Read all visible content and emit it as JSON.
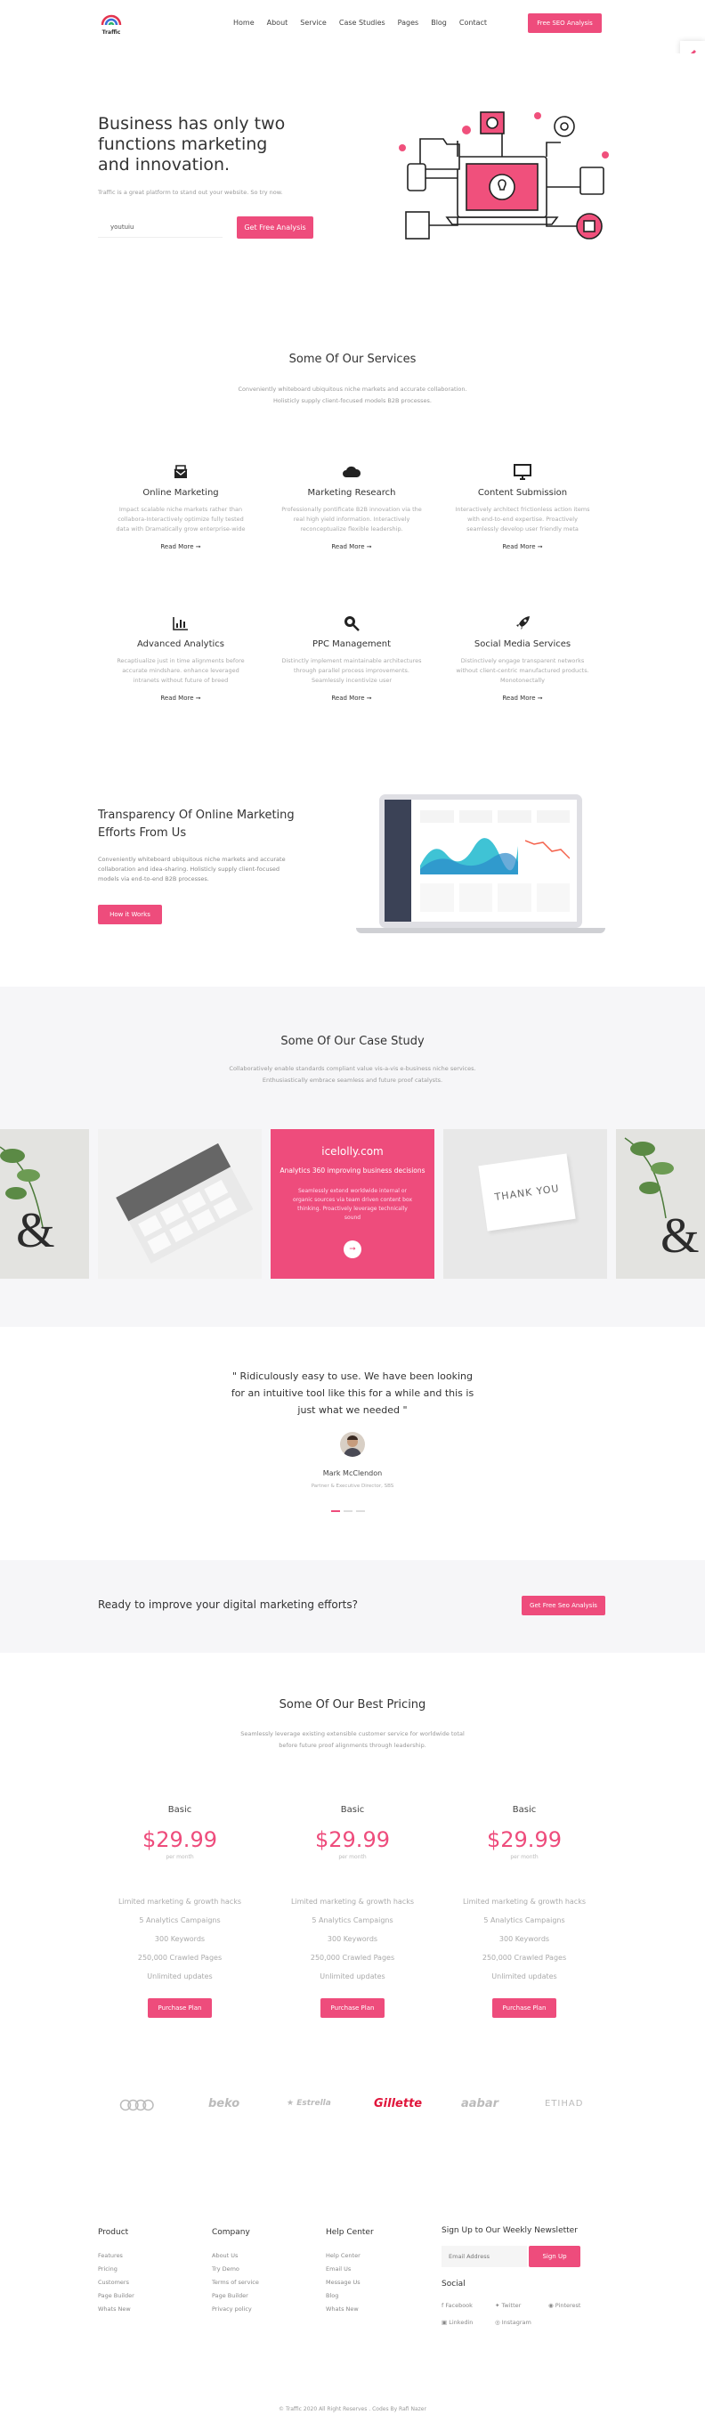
{
  "header": {
    "brand": "Traffic",
    "nav": [
      "Home",
      "About",
      "Service",
      "Case Studies",
      "Pages",
      "Blog",
      "Contact"
    ],
    "cta": "Free SEO Analysis"
  },
  "hero": {
    "title": "Business has only two functions marketing and innovation.",
    "subtitle": "Traffic is a great platform to stand out your website. So try now.",
    "input_value": "youtuiu",
    "button": "Get Free Analysis"
  },
  "services": {
    "title": "Some Of Our Services",
    "desc": "Conveniently whiteboard ubiquitous niche markets and accurate collaboration. Holisticly supply client-focused models B2B processes.",
    "read_more": "Read More",
    "items": [
      {
        "icon": "mail-icon",
        "title": "Online Marketing",
        "text": "Impact scalable niche markets rather than collabora-Interactively optimize fully tested data with Dramatically grow enterprise-wide"
      },
      {
        "icon": "cloud-icon",
        "title": "Marketing Research",
        "text": "Professionally pontificate B2B innovation via the real high yield information. Interactively reconceptualize flexible leadership."
      },
      {
        "icon": "monitor-icon",
        "title": "Content Submission",
        "text": "Interactively architect frictionless action items with end-to-end expertise. Proactively seamlessly develop user friendly meta"
      },
      {
        "icon": "chart-icon",
        "title": "Advanced Analytics",
        "text": "Recaptiualize just in time alignments before accurate mindshare. enhance leveraged intranets without future of breed"
      },
      {
        "icon": "search-icon",
        "title": "PPC Management",
        "text": "Distinctly implement maintainable architectures through parallel process improvements. Seamlessly incentivize user"
      },
      {
        "icon": "rocket-icon",
        "title": "Social Media Services",
        "text": "Distinctively engage transparent networks without client-centric manufactured products. Monotonectally"
      }
    ]
  },
  "transparency": {
    "title": "Transparency Of Online Marketing Efforts From Us",
    "text": "Conveniently whiteboard ubiquitous niche markets and accurate collaboration and idea-sharing. Holisticly supply client-focused models via end-to-end B2B processes.",
    "button": "How it Works"
  },
  "case_study": {
    "title": "Some Of Our Case Study",
    "desc": "Collaboratively enable standards compliant value vis-a-vis e-business niche services. Enthusiastically embrace seamless and future proof catalysts.",
    "card": {
      "site": "icelolly.com",
      "headline": "Analytics 360 improving business decisions",
      "text": "Seamlessly extend worldwide internal or organic sources via team driven content box thinking. Proactively leverage technically sound"
    },
    "thank_you": "THANK YOU"
  },
  "testimonial": {
    "quote": "\" Ridiculously easy to use. We have been looking for an intuitive tool like this for a while and this is just what we needed \"",
    "name": "Mark McClendon",
    "role": "Partner & Executive Director, SBS"
  },
  "cta_band": {
    "text": "Ready to improve your digital marketing efforts?",
    "button": "Get Free Seo Analysis"
  },
  "pricing": {
    "title": "Some Of Our Best Pricing",
    "desc": "Seamlessly leverage existing extensible customer service for worldwide total before future proof alignments through leadership.",
    "plans": [
      {
        "name": "Basic",
        "price": "$29.99",
        "period": "per month",
        "features": [
          "Limited marketing & growth hacks",
          "5 Analytics Campaigns",
          "300 Keywords",
          "250,000 Crawled Pages",
          "Unlimited updates"
        ],
        "button": "Purchase Plan"
      },
      {
        "name": "Basic",
        "price": "$29.99",
        "period": "per month",
        "features": [
          "Limited marketing & growth hacks",
          "5 Analytics Campaigns",
          "300 Keywords",
          "250,000 Crawled Pages",
          "Unlimited updates"
        ],
        "button": "Purchase Plan"
      },
      {
        "name": "Basic",
        "price": "$29.99",
        "period": "per month",
        "features": [
          "Limited marketing & growth hacks",
          "5 Analytics Campaigns",
          "300 Keywords",
          "250,000 Crawled Pages",
          "Unlimited updates"
        ],
        "button": "Purchase Plan"
      }
    ]
  },
  "logos": [
    "audi",
    "beko",
    "Estrella",
    "Gillette",
    "aabar",
    "ETIHAD"
  ],
  "footer": {
    "product": {
      "title": "Product",
      "links": [
        "Features",
        "Pricing",
        "Customers",
        "Page Builder",
        "Whats New"
      ]
    },
    "company": {
      "title": "Company",
      "links": [
        "About Us",
        "Try Demo",
        "Terms of service",
        "Page Builder",
        "Privacy policy"
      ]
    },
    "help": {
      "title": "Help Center",
      "links": [
        "Help Center",
        "Email Us",
        "Message Us",
        "Blog",
        "Whats New"
      ]
    },
    "newsletter": {
      "title": "Sign Up to Our Weekly Newsletter",
      "placeholder": "Email Address",
      "button": "Sign Up"
    },
    "social": {
      "title": "Social",
      "links": [
        "Facebook",
        "Twitter",
        "Pinterest",
        "Linkedin",
        "Instagram"
      ]
    },
    "copyright": "© Traffic 2020 All Right Reserves . Codes By Rafi Nazer"
  },
  "colors": {
    "accent": "#ee4c7c"
  }
}
